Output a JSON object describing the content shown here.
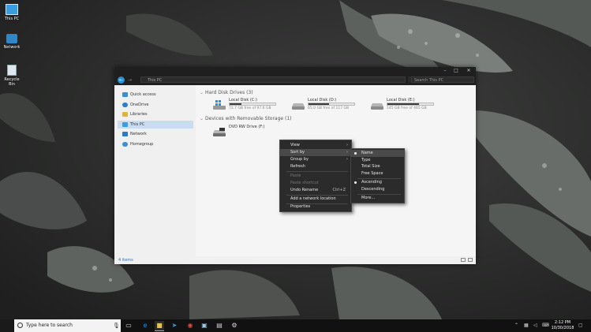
{
  "desktop": {
    "icons": [
      {
        "label": "This PC",
        "icon": "this-pc-icon"
      },
      {
        "label": "Network",
        "icon": "network-icon"
      },
      {
        "label": "Recycle Bin",
        "icon": "recycle-bin-icon"
      }
    ]
  },
  "explorer": {
    "address": "This PC",
    "search_placeholder": "Search This PC",
    "window_controls": {
      "minimize": "–",
      "maximize": "□",
      "close": "✕"
    },
    "nav": {
      "back": "←",
      "forward": "→",
      "items": [
        {
          "label": "Quick access",
          "icon": "star-icon",
          "selected": false
        },
        {
          "label": "OneDrive",
          "icon": "onedrive-cloud-icon",
          "selected": false
        },
        {
          "label": "Libraries",
          "icon": "libraries-icon",
          "selected": false
        },
        {
          "label": "This PC",
          "icon": "this-pc-icon",
          "selected": true
        },
        {
          "label": "Network",
          "icon": "network-icon",
          "selected": false
        },
        {
          "label": "Homegroup",
          "icon": "homegroup-icon",
          "selected": false
        }
      ]
    },
    "groups": {
      "hard_disk": "Hard Disk Drives (3)",
      "removable": "Devices with Removable Storage (1)"
    },
    "drives": [
      {
        "name": "Local Disk (C:)",
        "free": "72.7 GB free of 97.6 GB",
        "used_fraction": 0.26
      },
      {
        "name": "Local Disk (D:)",
        "free": "65.0 GB free of 117 GB",
        "used_fraction": 0.45
      },
      {
        "name": "Local Disk (E:)",
        "free": "145 GB free of 465 GB",
        "used_fraction": 0.69
      }
    ],
    "removable": [
      {
        "name": "DVD RW Drive (F:)",
        "icon": "dvd-drive-icon"
      }
    ],
    "status": "4 items"
  },
  "context_menu": {
    "items": [
      {
        "label": "View",
        "submenu": true,
        "disabled": false
      },
      {
        "label": "Sort by",
        "submenu": true,
        "disabled": false,
        "highlighted": true
      },
      {
        "label": "Group by",
        "submenu": true,
        "disabled": false
      },
      {
        "label": "Refresh",
        "disabled": false
      },
      {
        "label": "Paste",
        "disabled": true
      },
      {
        "label": "Paste shortcut",
        "disabled": true
      },
      {
        "label": "Undo Rename",
        "shortcut": "Ctrl+Z",
        "disabled": false
      },
      {
        "label": "Add a network location",
        "disabled": false
      },
      {
        "label": "Properties",
        "disabled": false
      }
    ]
  },
  "sort_submenu": {
    "items": [
      {
        "label": "Name",
        "checked": true
      },
      {
        "label": "Type",
        "checked": false
      },
      {
        "label": "Total Size",
        "checked": false
      },
      {
        "label": "Free Space",
        "checked": false
      },
      {
        "label": "Ascending",
        "checked": true
      },
      {
        "label": "Descending",
        "checked": false
      },
      {
        "label": "More...",
        "checked": false
      }
    ]
  },
  "taskbar": {
    "search_placeholder": "Type here to search",
    "pinned": [
      "task-view-icon",
      "edge-icon",
      "file-explorer-icon",
      "telegram-icon",
      "chrome-icon",
      "app-icon",
      "photos-icon",
      "settings-icon"
    ],
    "clock_time": "2:12 PM",
    "clock_date": "10/30/2018"
  }
}
